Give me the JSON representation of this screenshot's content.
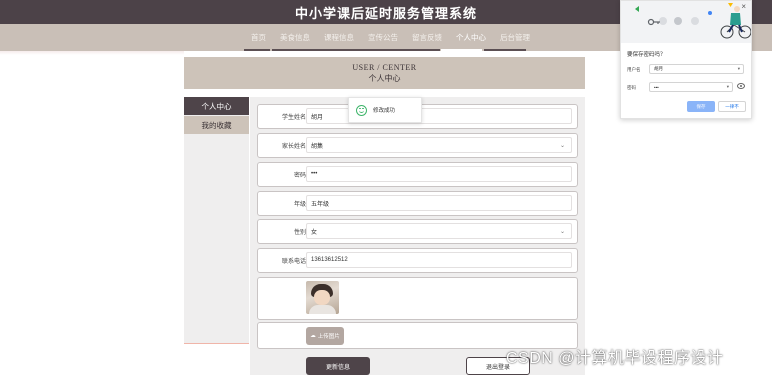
{
  "header": {
    "site_title": "中小学课后延时服务管理系统"
  },
  "nav": {
    "items": [
      {
        "label": "首页"
      },
      {
        "label": "美食信息"
      },
      {
        "label": "课程信息"
      },
      {
        "label": "宣传公告"
      },
      {
        "label": "留言反馈"
      },
      {
        "label": "个人中心"
      },
      {
        "label": "后台管理"
      }
    ],
    "active": "个人中心"
  },
  "banner": {
    "title_en": "USER / CENTER",
    "title_zh": "个人中心"
  },
  "side_menu": {
    "items": [
      {
        "label": "个人中心"
      },
      {
        "label": "我的收藏"
      }
    ]
  },
  "form": {
    "student_name": {
      "label": "学生姓名",
      "value": "胡月"
    },
    "parent_name": {
      "label": "家长姓名",
      "value": "胡集"
    },
    "password": {
      "label": "密码",
      "value": "•••"
    },
    "grade": {
      "label": "年级",
      "value": "五年级"
    },
    "gender": {
      "label": "性别",
      "value": "女"
    },
    "phone": {
      "label": "联系电话",
      "value": "13613612512"
    },
    "upload_label": "上传图片",
    "update_button": "更新信息",
    "logout_button": "退出登录"
  },
  "toast": {
    "message": "修改成功"
  },
  "password_popup": {
    "title": "要保存密码吗？",
    "username_label": "用户名",
    "username_value": "胡月",
    "password_label": "密码",
    "password_value": "•••",
    "save_button": "保存",
    "never_button": "一律不"
  },
  "watermark": "CSDN @计算机毕设程序设计",
  "colors": {
    "header_bg": "#4c4248",
    "nav_bg": "#c9bfb7",
    "banner_bg": "#cdc3b9",
    "accent_dark": "#4e4449",
    "toast_green": "#3fb56b",
    "popup_save_blue": "#8ab4f8"
  }
}
